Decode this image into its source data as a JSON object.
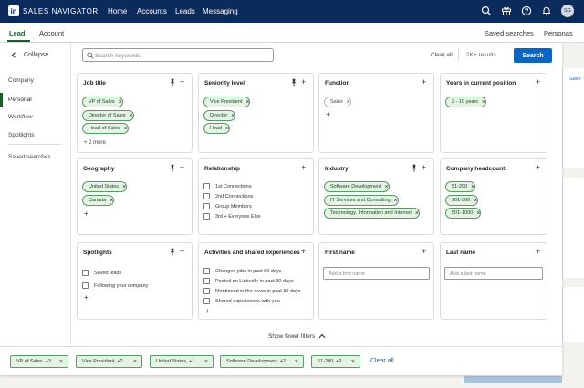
{
  "nav": {
    "logo": "in",
    "brand": "SALES NAVIGATOR",
    "links": [
      "Home",
      "Accounts",
      "Leads",
      "Messaging"
    ],
    "avatar": "SG"
  },
  "subnav": {
    "tabs": [
      "Lead",
      "Account"
    ],
    "right": [
      "Saved searches",
      "Personas"
    ]
  },
  "background": {
    "save_link": "Save"
  },
  "sidebar": {
    "collapse": "Collapse",
    "items": [
      "Company",
      "Personal",
      "Workflow",
      "Spotlights"
    ],
    "saved": "Saved searches"
  },
  "search": {
    "placeholder": "Search keywords",
    "clear_all": "Clear all",
    "results": "2K+ results",
    "button": "Search"
  },
  "filters": {
    "job_title": {
      "title": "Job title",
      "chips": [
        "VP of Sales",
        "Director of Sales",
        "Head of Sales"
      ],
      "more": "+ 2 more"
    },
    "seniority": {
      "title": "Seniority level",
      "chips": [
        "Vice President",
        "Director",
        "Head"
      ]
    },
    "function": {
      "title": "Function",
      "chips": [
        "Sales"
      ]
    },
    "years": {
      "title": "Years in current position",
      "chips": [
        "2 - 10 years"
      ]
    },
    "geography": {
      "title": "Geography",
      "chips": [
        "United States",
        "Canada"
      ]
    },
    "relationship": {
      "title": "Relationship",
      "options": [
        "1st Connections",
        "2nd Connections",
        "Group Members",
        "3rd + Everyone Else"
      ]
    },
    "industry": {
      "title": "Industry",
      "chips": [
        "Software Development",
        "IT Services and Consulting",
        "Technology, Information and Internet"
      ]
    },
    "headcount": {
      "title": "Company headcount",
      "chips": [
        "51-200",
        "201-500",
        "501-1000"
      ]
    },
    "spotlights": {
      "title": "Spotlights",
      "options": [
        "Saved leads",
        "Following your company"
      ]
    },
    "activities": {
      "title": "Activities and shared experiences",
      "options": [
        "Changed jobs in past 90 days",
        "Posted on LinkedIn in past 30 days",
        "Mentioned in the news in past 30 days",
        "Shared experiences with you"
      ]
    },
    "first_name": {
      "title": "First name",
      "placeholder": "Add a first name"
    },
    "last_name": {
      "title": "Last name",
      "placeholder": "Add a last name"
    }
  },
  "show_fewer": "Show fewer filters",
  "applied": {
    "pills": [
      "VP of Sales, +3",
      "Vice President, +2",
      "United States, +1",
      "Software Development, +2",
      "51-200, +2"
    ],
    "clear_all": "Clear all"
  },
  "colors": {
    "nav": "#0a2b5c",
    "accent_green": "#1a5e2a",
    "chip_bg": "#e4f3e3",
    "search_blue": "#0a66c2"
  }
}
